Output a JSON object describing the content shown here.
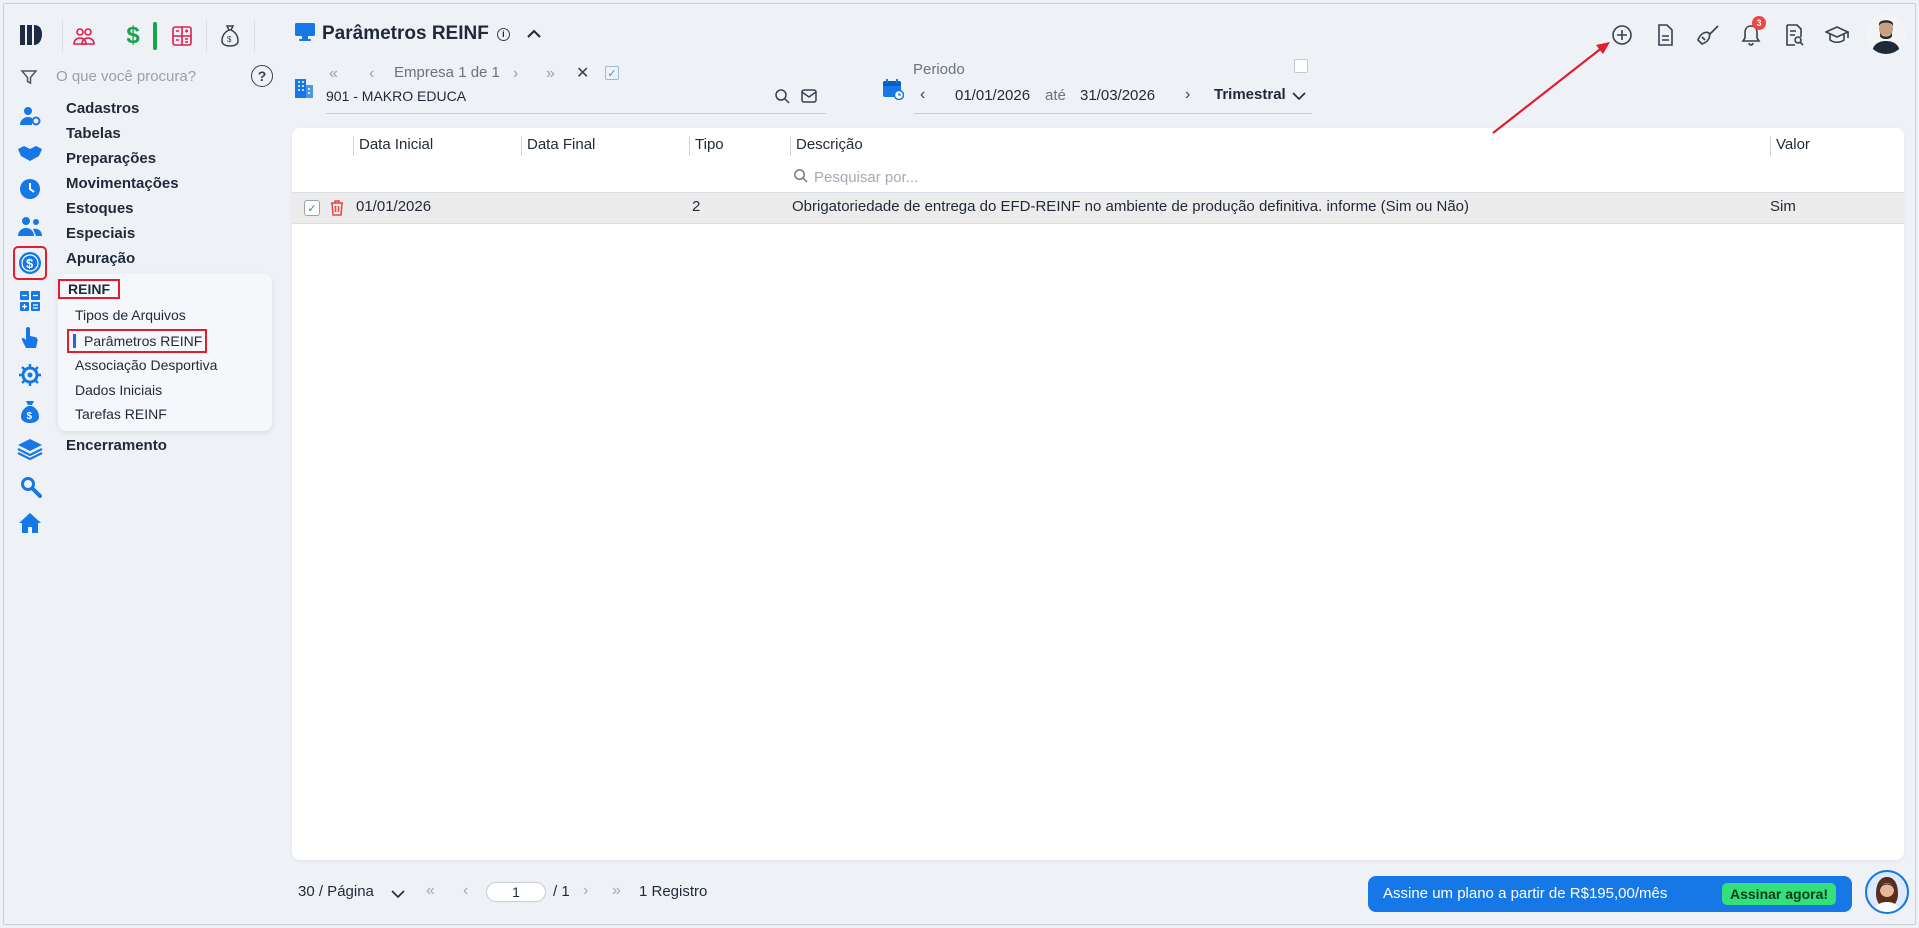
{
  "search": {
    "placeholder": "O que você procura?"
  },
  "menu": {
    "items": [
      "Cadastros",
      "Tabelas",
      "Preparações",
      "Movimentações",
      "Estoques",
      "Especiais",
      "Apuração"
    ],
    "group_title": "REINF",
    "sub_items": [
      "Tipos de Arquivos",
      "Parâmetros REINF",
      "Associação Desportiva",
      "Dados Iniciais",
      "Tarefas REINF"
    ],
    "last_item": "Encerramento"
  },
  "header": {
    "title": "Parâmetros REINF",
    "notification_count": "3"
  },
  "empresa": {
    "nav_label": "Empresa 1 de 1",
    "value": "901 - MAKRO EDUCA"
  },
  "periodo": {
    "label": "Periodo",
    "start": "01/01/2026",
    "separator": "até",
    "end": "31/03/2026",
    "type": "Trimestral"
  },
  "table": {
    "columns": [
      "Data Inicial",
      "Data Final",
      "Tipo",
      "Descrição",
      "Valor"
    ],
    "filter_placeholder": "Pesquisar por...",
    "rows": [
      {
        "data_inicial": "01/01/2026",
        "data_final": "",
        "tipo": "2",
        "descricao": "Obrigatoriedade de entrega do EFD-REINF no ambiente de produção definitiva. informe (Sim ou Não)",
        "valor": "Sim"
      }
    ]
  },
  "footer": {
    "per_page": "30 / Página",
    "page": "1",
    "total_pages": "/ 1",
    "records": "1 Registro"
  },
  "promo": {
    "text": "Assine um plano a partir de R$195,00/mês",
    "button": "Assinar agora!"
  },
  "colors": {
    "primary": "#1677e6",
    "highlight": "#e11d2e",
    "cta": "#33e07a",
    "accent_green": "#16a34a"
  }
}
